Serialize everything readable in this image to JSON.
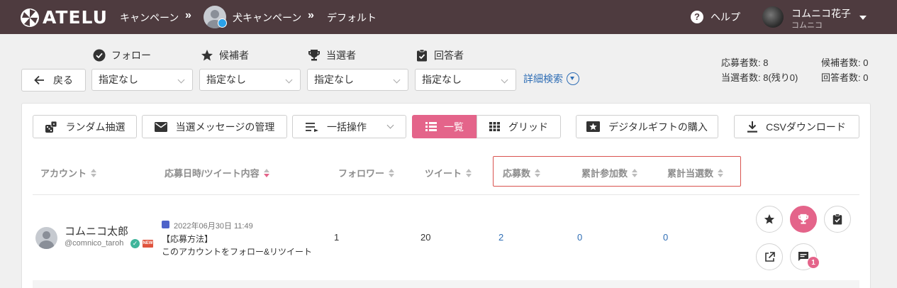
{
  "header": {
    "logo_text": "ATELU",
    "breadcrumb": [
      "キャンペーン",
      "犬キャンペーン",
      "デフォルト"
    ],
    "separator": "»",
    "help_label": "ヘルプ",
    "user_name": "コムニコ花子",
    "user_org": "コムニコ"
  },
  "filters": {
    "back_label": "戻る",
    "follow_label": "フォロー",
    "candidate_label": "候補者",
    "winner_label": "当選者",
    "respondent_label": "回答者",
    "follow_value": "指定なし",
    "candidate_value": "指定なし",
    "winner_value": "指定なし",
    "respondent_value": "指定なし",
    "detail_search": "詳細検索"
  },
  "stats": {
    "applicants": "応募者数: 8",
    "candidates": "候補者数: 0",
    "winners": "当選者数: 8(残り0)",
    "respondents": "回答者数: 0"
  },
  "toolbar": {
    "random_draw": "ランダム抽選",
    "winner_messages": "当選メッセージの管理",
    "bulk_action": "一括操作",
    "view_list": "一覧",
    "view_grid": "グリッド",
    "digital_gift": "デジタルギフトの購入",
    "csv_download": "CSVダウンロード"
  },
  "table": {
    "columns": [
      "アカウント",
      "応募日時/ツイート内容",
      "フォロワー",
      "ツイート",
      "応募数",
      "累計参加数",
      "累計当選数"
    ],
    "rows": [
      {
        "name": "コムニコ太郎",
        "handle": "@comnico_taroh",
        "new_badge": "NEW",
        "verified_mark": "✓",
        "date": "2022年06月30日 11:49",
        "tweet_line1": "【応募方法】",
        "tweet_line2": "このアカウントをフォロー&リツイート",
        "followers": "1",
        "tweets": "20",
        "entries": "2",
        "total_participation": "0",
        "total_wins": "0",
        "message_count": "1"
      }
    ]
  },
  "colors": {
    "header_bg": "#4e3b3f",
    "accent_pink": "#e4648a",
    "link_blue": "#2f6eb5",
    "highlight_red": "#d9534f"
  }
}
